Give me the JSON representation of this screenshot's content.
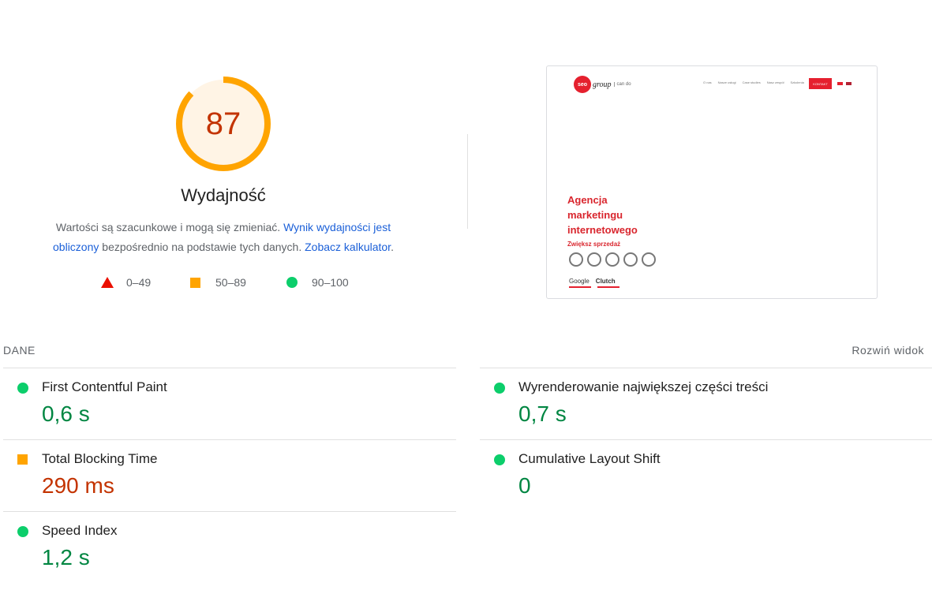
{
  "gauge": {
    "score": "87",
    "fraction": 0.87,
    "color": "#ffa400",
    "score_color": "#c33300"
  },
  "category_title": "Wydajność",
  "description": {
    "text_1": "Wartości są szacunkowe i mogą się zmieniać. ",
    "link_1": "Wynik wydajności jest obliczony",
    "text_2": " bezpośrednio na podstawie tych danych. ",
    "link_2": "Zobacz kalkulator",
    "text_3": "."
  },
  "legend": [
    {
      "range": "0–49",
      "shape": "triangle-icon",
      "color": "#eb0f00"
    },
    {
      "range": "50–89",
      "shape": "square-icon",
      "color": "#ffa400"
    },
    {
      "range": "90–100",
      "shape": "circle-icon",
      "color": "#0cce6b"
    }
  ],
  "screenshot": {
    "logo_badge": "seo",
    "logo_text": "group",
    "logo_cando": "can do",
    "nav": [
      "O nas",
      "Nasze usługi",
      "Case studies",
      "Nasz zespół",
      "Szkolenia"
    ],
    "cta": "KONTAKT",
    "hero_lines": [
      "Agencja",
      "marketingu",
      "internetowego"
    ],
    "hero_sub": "Zwiększ sprzedaż",
    "brands": [
      "Google",
      "Clutch"
    ]
  },
  "section": {
    "label": "DANE",
    "expand_label": "Rozwiń widok"
  },
  "metrics": {
    "left": [
      {
        "name": "First Contentful Paint",
        "value": "0,6 s",
        "status": "good"
      },
      {
        "name": "Total Blocking Time",
        "value": "290 ms",
        "status": "average"
      },
      {
        "name": "Speed Index",
        "value": "1,2 s",
        "status": "good"
      }
    ],
    "right": [
      {
        "name": "Wyrenderowanie największej części treści",
        "value": "0,7 s",
        "status": "good"
      },
      {
        "name": "Cumulative Layout Shift",
        "value": "0",
        "status": "good"
      }
    ]
  }
}
